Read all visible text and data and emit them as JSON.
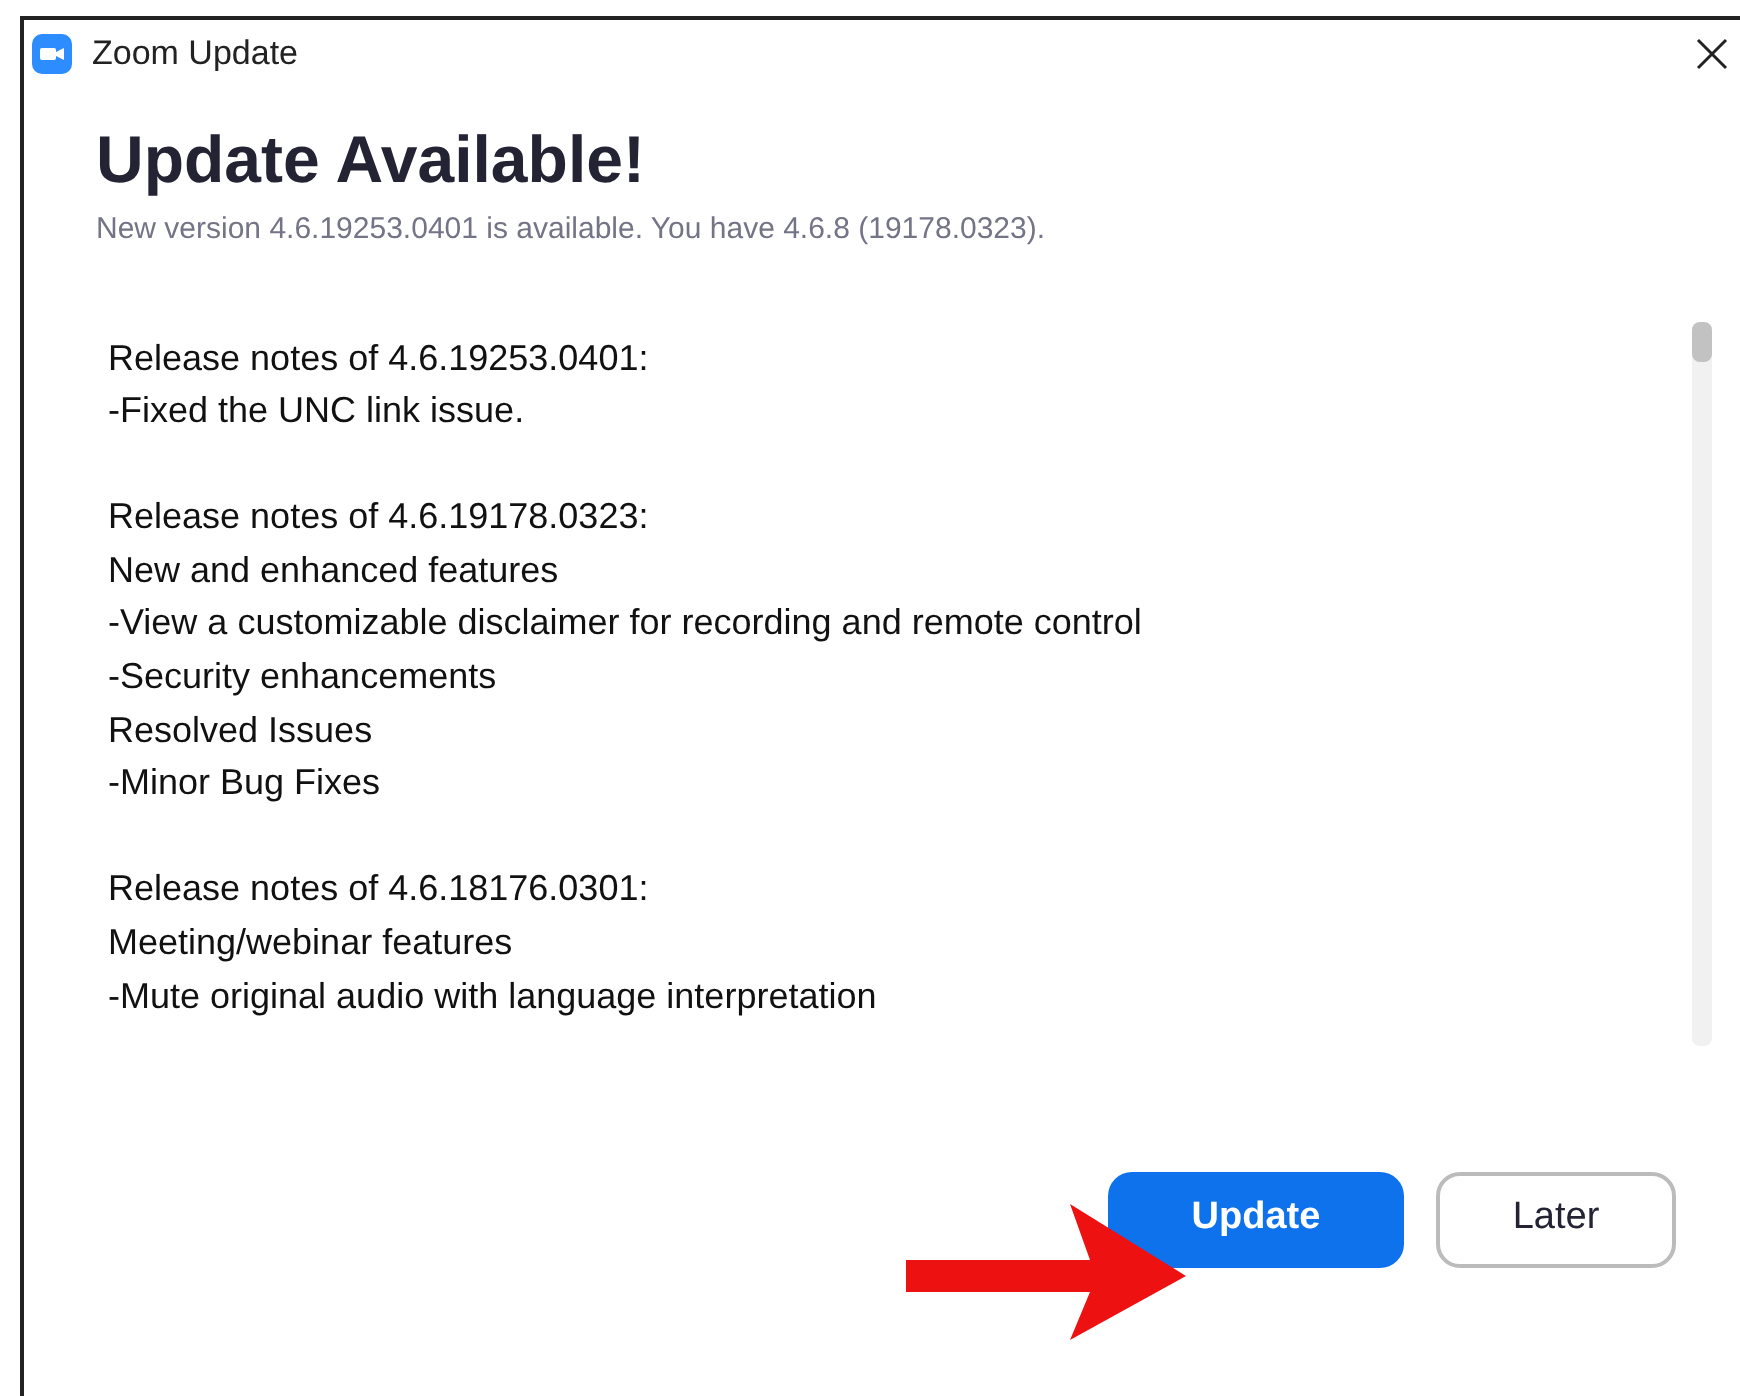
{
  "window": {
    "title": "Zoom Update"
  },
  "heading": "Update Available!",
  "subtitle": "New version 4.6.19253.0401 is available. You have 4.6.8 (19178.0323).",
  "release_notes": [
    {
      "lines": [
        "Release notes of 4.6.19253.0401:",
        "-Fixed the UNC link issue."
      ]
    },
    {
      "lines": [
        "Release notes of 4.6.19178.0323:",
        "New and enhanced features",
        "-View a customizable disclaimer for recording and remote control",
        "-Security enhancements",
        "Resolved Issues",
        "-Minor Bug Fixes"
      ]
    },
    {
      "lines": [
        "Release notes of 4.6.18176.0301:",
        "Meeting/webinar features",
        "-Mute original audio with language interpretation"
      ]
    }
  ],
  "buttons": [
    {
      "label": "Update",
      "kind": "primary"
    },
    {
      "label": "Later",
      "kind": "secondary"
    }
  ]
}
